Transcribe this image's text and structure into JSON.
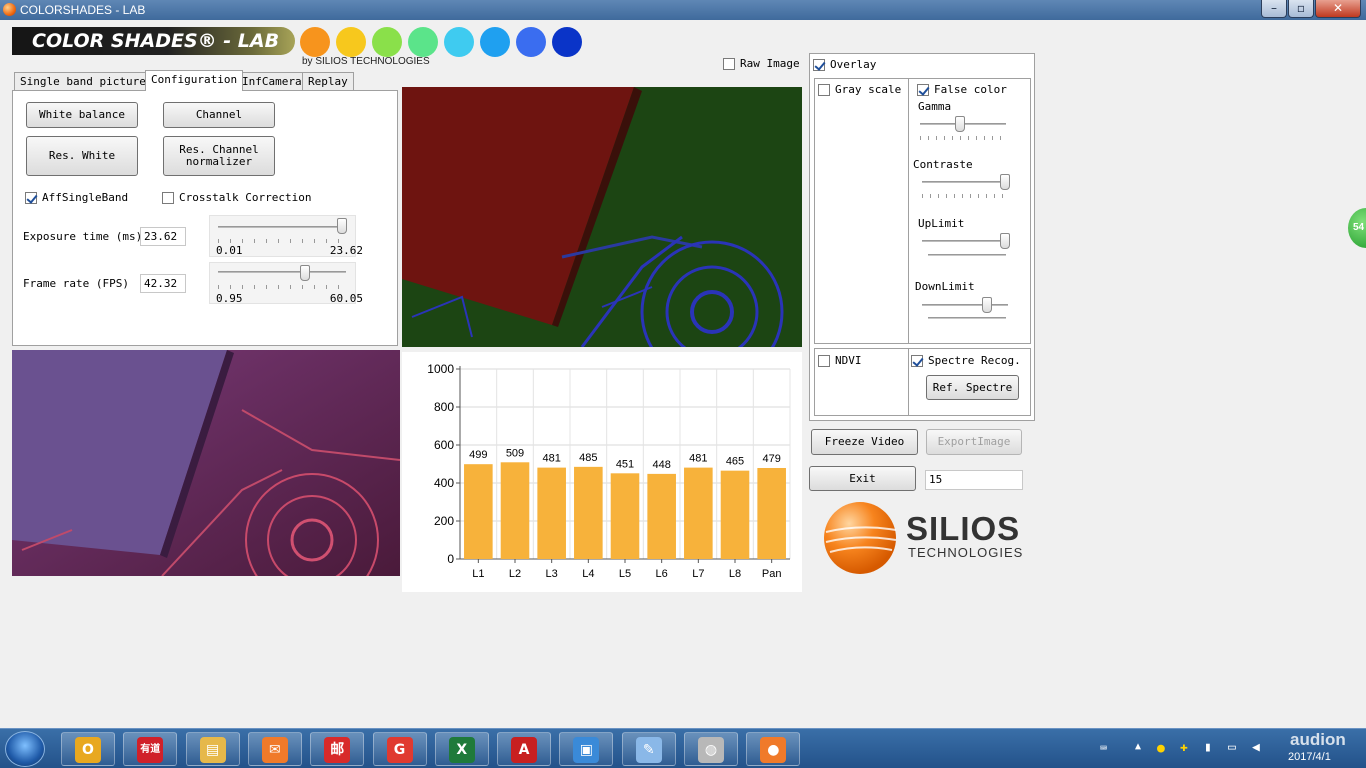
{
  "window": {
    "title": "COLORSHADES - LAB",
    "minimize": "–",
    "maximize": "▫",
    "close": "✕"
  },
  "header": {
    "logo_text": "COLOR SHADES® - LAB",
    "by_text": "by SILIOS TECHNOLOGIES",
    "swatches": [
      "#f7941d",
      "#f7c81d",
      "#8ae04a",
      "#5be48a",
      "#3fcbf0",
      "#1fa0f0",
      "#3a6df0",
      "#0a34c8"
    ]
  },
  "raw_image": {
    "label": "Raw Image",
    "checked": false
  },
  "tabs": [
    {
      "label": "Single band pictures",
      "active": false
    },
    {
      "label": "Configuration",
      "active": true
    },
    {
      "label": "InfCamera",
      "active": false
    },
    {
      "label": "Replay",
      "active": false
    }
  ],
  "config": {
    "white_balance": "White balance",
    "channel": "Channel",
    "res_white": "Res. White",
    "res_channel": "Res. Channel\nnormalizer",
    "aff_single_band": {
      "label": "AffSingleBand",
      "checked": true
    },
    "crosstalk": {
      "label": "Crosstalk Correction",
      "checked": false
    },
    "exposure": {
      "label": "Exposure time (ms)",
      "value": "23.62",
      "min": "0.01",
      "max": "23.62",
      "level": 1.0
    },
    "frame_rate": {
      "label": "Frame rate (FPS)",
      "value": "42.32",
      "min": "0.95",
      "max": "60.05",
      "level": 0.7
    }
  },
  "overlay": {
    "label": "Overlay",
    "checked": true
  },
  "gray_scale": {
    "label": "Gray scale",
    "checked": false
  },
  "false_color": {
    "label": "False color",
    "checked": true
  },
  "sliders": {
    "gamma": {
      "label": "Gamma",
      "level": 0.45
    },
    "contraste": {
      "label": "Contraste",
      "level": 0.98
    },
    "uplimit": {
      "label": "UpLimit",
      "level": 0.98
    },
    "downlimit": {
      "label": "DownLimit",
      "level": 0.75
    }
  },
  "ndvi": {
    "label": "NDVI",
    "checked": false
  },
  "spectre_recog": {
    "label": "Spectre Recog.",
    "checked": true
  },
  "ref_spectre": "Ref. Spectre",
  "freeze_video": "Freeze Video",
  "export_image": "ExportImage",
  "exit": "Exit",
  "counter": "15",
  "brand": {
    "name": "SILIOS",
    "sub": "TECHNOLOGIES"
  },
  "edge_badge": "54",
  "chart_data": {
    "type": "bar",
    "categories": [
      "L1",
      "L2",
      "L3",
      "L4",
      "L5",
      "L6",
      "L7",
      "L8",
      "Pan"
    ],
    "values": [
      499,
      509,
      481,
      485,
      451,
      448,
      481,
      465,
      479
    ],
    "ylim": [
      0,
      1000
    ],
    "yticks": [
      0,
      200,
      400,
      600,
      800,
      1000
    ],
    "grid": true,
    "bar_color": "#f7b23b"
  },
  "taskbar": {
    "tray_brand": "audion",
    "date": "2017/4/1",
    "apps": [
      {
        "name": "outlook-icon",
        "glyph": "O",
        "color": "#e8a820"
      },
      {
        "name": "youdao-icon",
        "glyph": "有道",
        "color": "#d0202a"
      },
      {
        "name": "explorer-icon",
        "glyph": "▤",
        "color": "#e6b84a"
      },
      {
        "name": "foxmail-icon",
        "glyph": "✉",
        "color": "#f07a2a"
      },
      {
        "name": "mail-icon",
        "glyph": "邮",
        "color": "#d82a2a"
      },
      {
        "name": "sogou-icon",
        "glyph": "G",
        "color": "#e03a30"
      },
      {
        "name": "excel-icon",
        "glyph": "X",
        "color": "#1f7a3a"
      },
      {
        "name": "pdf-icon",
        "glyph": "A",
        "color": "#c82020"
      },
      {
        "name": "photos-icon",
        "glyph": "▣",
        "color": "#3a8ad8"
      },
      {
        "name": "paint-icon",
        "glyph": "✎",
        "color": "#8ab8e8"
      },
      {
        "name": "globe-icon",
        "glyph": "◍",
        "color": "#b8b8b8"
      },
      {
        "name": "colorshades-icon",
        "glyph": "●",
        "color": "#f07a2a"
      }
    ]
  }
}
